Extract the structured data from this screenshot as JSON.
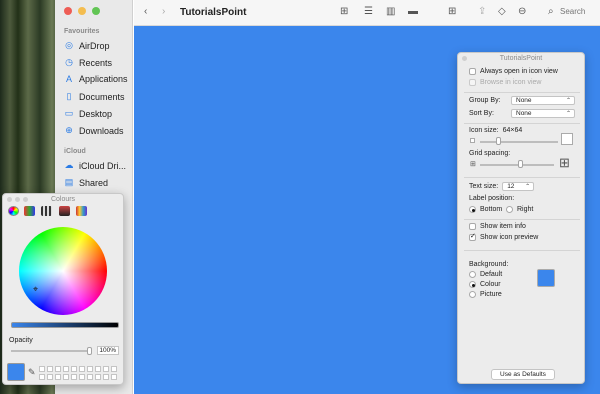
{
  "sidebar": {
    "sections": [
      {
        "label": "Favourites"
      },
      {
        "label": "iCloud"
      }
    ],
    "items": [
      {
        "label": "AirDrop",
        "icon": "airdrop-icon"
      },
      {
        "label": "Recents",
        "icon": "clock-icon"
      },
      {
        "label": "Applications",
        "icon": "applications-icon"
      },
      {
        "label": "Documents",
        "icon": "document-icon"
      },
      {
        "label": "Desktop",
        "icon": "desktop-icon"
      },
      {
        "label": "Downloads",
        "icon": "download-icon"
      },
      {
        "label": "iCloud Dri...",
        "icon": "cloud-icon"
      },
      {
        "label": "Shared",
        "icon": "shared-folder-icon"
      }
    ]
  },
  "toolbar": {
    "title": "TutorialsPoint",
    "search_placeholder": "Search"
  },
  "view_options": {
    "title": "TutorialsPoint",
    "always_open": "Always open in icon view",
    "browse_in_icon": "Browse in icon view",
    "group_by_label": "Group By:",
    "group_by_value": "None",
    "sort_by_label": "Sort By:",
    "sort_by_value": "None",
    "icon_size_label": "Icon size:",
    "icon_size_value": "64×64",
    "grid_spacing_label": "Grid spacing:",
    "text_size_label": "Text size:",
    "text_size_value": "12",
    "label_position_label": "Label position:",
    "label_bottom": "Bottom",
    "label_right": "Right",
    "show_item_info": "Show item info",
    "show_icon_preview": "Show icon preview",
    "background_label": "Background:",
    "bg_default": "Default",
    "bg_colour": "Colour",
    "bg_picture": "Picture",
    "use_defaults": "Use as Defaults"
  },
  "colours_panel": {
    "title": "Colours",
    "opacity_label": "Opacity",
    "opacity_value": "100%"
  },
  "colors": {
    "background_colour": "#3b86ec"
  }
}
